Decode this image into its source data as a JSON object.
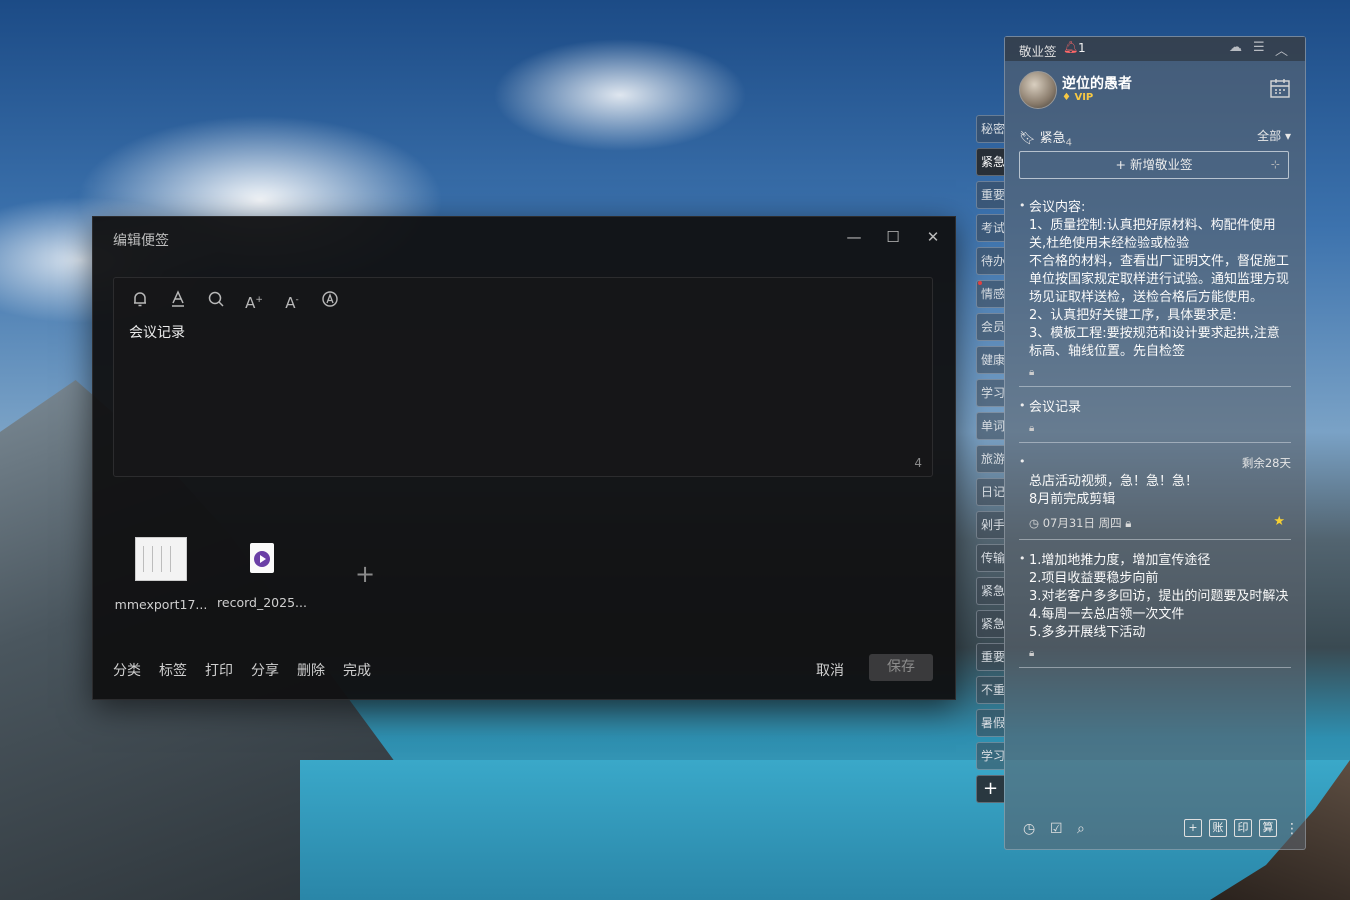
{
  "editor": {
    "title": "编辑便签",
    "content": "会议记录",
    "char_count": "4",
    "attachments": [
      {
        "name": "mmexport17..."
      },
      {
        "name": "record_2025..."
      }
    ],
    "actions": [
      "分类",
      "标签",
      "打印",
      "分享",
      "删除",
      "完成"
    ],
    "cancel_label": "取消",
    "save_label": "保存"
  },
  "panel": {
    "app_name": "敬业签",
    "notif_count": "1",
    "username": "逆位的愚者",
    "vip_label": "VIP",
    "category": "紧急",
    "category_count": "4",
    "filter": "全部",
    "new_note_label": "新增敬业签",
    "side_tabs": [
      "秘密",
      "紧急",
      "重要",
      "考试",
      "待办",
      "情感",
      "会员",
      "健康",
      "学习",
      "单词",
      "旅游",
      "日记",
      "剁手",
      "传输",
      "紧急",
      "紧急",
      "重要",
      "不重",
      "暑假",
      "学习"
    ],
    "notes": [
      {
        "lines": [
          "会议内容:",
          "1、质量控制:认真把好原材料、构配件使用关,杜绝使用未经检验或检验",
          "不合格的材料，查看出厂证明文件，督促施工单位按国家规定取样进行试验。通知监理方现场见证取样送检，送检合格后方能使用。",
          "2、认真把好关键工序，具体要求是:",
          "3、模板工程:要按规范和设计要求起拱,注意标高、轴线位置。先自检签"
        ]
      },
      {
        "lines": [
          "会议记录"
        ]
      },
      {
        "remaining": "剩余28天",
        "lines": [
          "总店活动视频，急！急！急！",
          "8月前完成剪辑"
        ],
        "date": "07月31日 周四"
      },
      {
        "lines": [
          "1.增加地推力度，增加宣传途径",
          "2.项目收益要稳步向前",
          "3.对老客户多多回访，提出的问题要及时解决",
          "4.每周一去总店领一次文件",
          "5.多多开展线下活动"
        ]
      }
    ],
    "footer_boxes": [
      "+",
      "账",
      "印",
      "算"
    ]
  }
}
